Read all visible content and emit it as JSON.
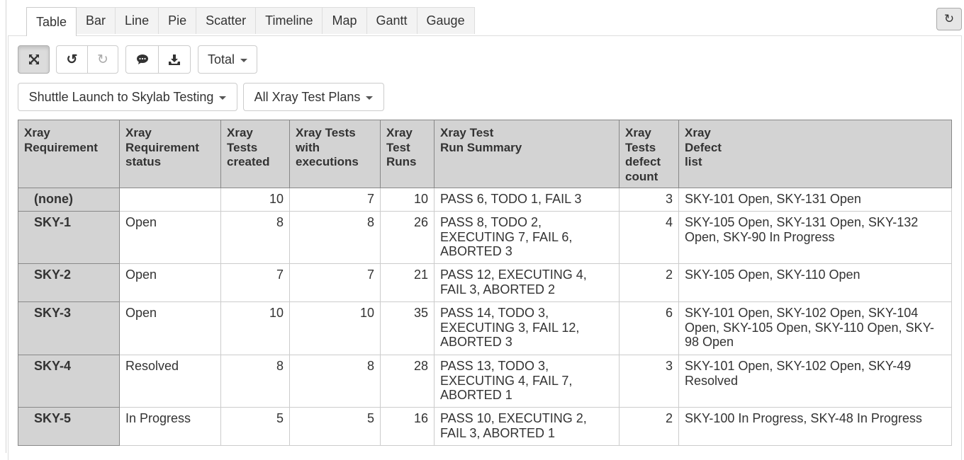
{
  "tabs": [
    {
      "label": "Table",
      "active": true
    },
    {
      "label": "Bar"
    },
    {
      "label": "Line"
    },
    {
      "label": "Pie"
    },
    {
      "label": "Scatter"
    },
    {
      "label": "Timeline"
    },
    {
      "label": "Map"
    },
    {
      "label": "Gantt"
    },
    {
      "label": "Gauge"
    }
  ],
  "toolbar": {
    "total_label": "Total",
    "project_dropdown": "Shuttle Launch to Skylab Testing",
    "testplan_dropdown": "All Xray Test Plans"
  },
  "table": {
    "headers": [
      [
        "Xray",
        "Requirement"
      ],
      [
        "Xray",
        "Requirement",
        "status"
      ],
      [
        "Xray",
        "Tests",
        "created"
      ],
      [
        "Xray Tests",
        "with",
        "executions"
      ],
      [
        "Xray",
        "Test",
        "Runs"
      ],
      [
        "Xray Test",
        "Run Summary"
      ],
      [
        "Xray",
        "Tests",
        "defect",
        "count"
      ],
      [
        "Xray",
        "Defect",
        "list"
      ]
    ],
    "rows": [
      {
        "req": "(none)",
        "status": "",
        "created": "10",
        "with_exec": "7",
        "runs": "10",
        "summary": [
          "PASS 6, TODO 1, FAIL 3"
        ],
        "defects": "3",
        "defect_list": [
          "SKY-101 Open, SKY-131 Open"
        ]
      },
      {
        "req": "SKY-1",
        "status": "Open",
        "created": "8",
        "with_exec": "8",
        "runs": "26",
        "summary": [
          "PASS 8, TODO 2,",
          "EXECUTING 7, FAIL 6,",
          "ABORTED 3"
        ],
        "defects": "4",
        "defect_list": [
          "SKY-105 Open, SKY-131 Open, SKY-132",
          "Open, SKY-90 In Progress"
        ]
      },
      {
        "req": "SKY-2",
        "status": "Open",
        "created": "7",
        "with_exec": "7",
        "runs": "21",
        "summary": [
          "PASS 12, EXECUTING 4,",
          "FAIL 3, ABORTED 2"
        ],
        "defects": "2",
        "defect_list": [
          "SKY-105 Open, SKY-110 Open"
        ]
      },
      {
        "req": "SKY-3",
        "status": "Open",
        "created": "10",
        "with_exec": "10",
        "runs": "35",
        "summary": [
          "PASS 14, TODO 3,",
          "EXECUTING 3, FAIL 12,",
          "ABORTED 3"
        ],
        "defects": "6",
        "defect_list": [
          "SKY-101 Open, SKY-102 Open, SKY-104",
          "Open, SKY-105 Open, SKY-110 Open, SKY-",
          "98 Open"
        ]
      },
      {
        "req": "SKY-4",
        "status": "Resolved",
        "created": "8",
        "with_exec": "8",
        "runs": "28",
        "summary": [
          "PASS 13, TODO 3,",
          "EXECUTING 4, FAIL 7,",
          "ABORTED 1"
        ],
        "defects": "3",
        "defect_list": [
          "SKY-101 Open, SKY-102 Open, SKY-49",
          "Resolved"
        ]
      },
      {
        "req": "SKY-5",
        "status": "In Progress",
        "created": "5",
        "with_exec": "5",
        "runs": "16",
        "summary": [
          "PASS 10, EXECUTING 2,",
          "FAIL 3, ABORTED 1"
        ],
        "defects": "2",
        "defect_list": [
          "SKY-100 In Progress, SKY-48 In Progress"
        ]
      }
    ]
  }
}
